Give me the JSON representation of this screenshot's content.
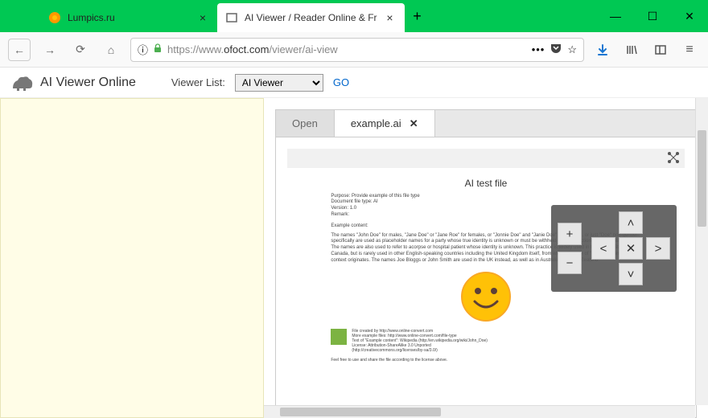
{
  "window": {
    "tabs": [
      {
        "title": "Lumpics.ru",
        "active": false
      },
      {
        "title": "AI Viewer / Reader Online & Fr",
        "active": true
      }
    ],
    "controls": {
      "min": "—",
      "max": "☐",
      "close": "✕"
    }
  },
  "toolbar": {
    "back": "←",
    "forward": "→",
    "reload": "⟳",
    "home": "⌂",
    "url_info": "ⓘ",
    "lock": "🔒",
    "url_prefix": "https://www.",
    "url_host": "ofoct.com",
    "url_path": "/viewer/ai-view",
    "more": "•••",
    "pocket": "▾",
    "star": "☆",
    "download": "⬇",
    "library": "|||\\",
    "sidebar": "▣",
    "menu": "≡"
  },
  "app": {
    "brand": "AI Viewer Online",
    "viewer_list_label": "Viewer List:",
    "viewer_select": "AI Viewer",
    "go": "GO"
  },
  "viewer": {
    "open_tab": "Open",
    "file_tab": "example.ai",
    "close": "✕"
  },
  "doc": {
    "title": "AI test file",
    "meta": "Purpose: Provide example of this file type\nDocument file type: AI\nVersion: 1.0\nRemark:",
    "example_label": "Example content:",
    "body": "The names \"John Doe\" for males, \"Jane Doe\" or \"Jane Roe\" for females, or \"Jonnie Doe\" and \"Janie Doe\" for children, or just \"Doe\" non-gender-specifically are used as placeholder names for a party whose true identity is unknown or must be withheld in a legal action, case, or discussion. The names are also used to refer to acorpse or hospital patient whose identity is unknown. This practice is widely used in the United States and Canada, but is rarely used in other English-speaking countries including the United Kingdom itself, from where the use of \"John Doe\" in a legal context originates. The names Joe Bloggs or John Smith are used in the UK instead, as well as in Australia and New Zealand.",
    "footer": "File created by http://www.online-convert.com\nMore example files: http://www.online-convert.com/file-type\nText of \"Example content\": Wikipedia (http://en.wikipedia.org/wiki/John_Doe)\nLicense: Attribution-ShareAlike 3.0 Unported\n(http://creativecommons.org/licenses/by-sa/3.0/)",
    "feel_free": "Feel free to use and share the file according to the license above."
  },
  "controls": {
    "zoom_in": "+",
    "zoom_out": "−",
    "up": "˄",
    "left": "˂",
    "center": "✕",
    "right": "˃",
    "down": "˅"
  }
}
